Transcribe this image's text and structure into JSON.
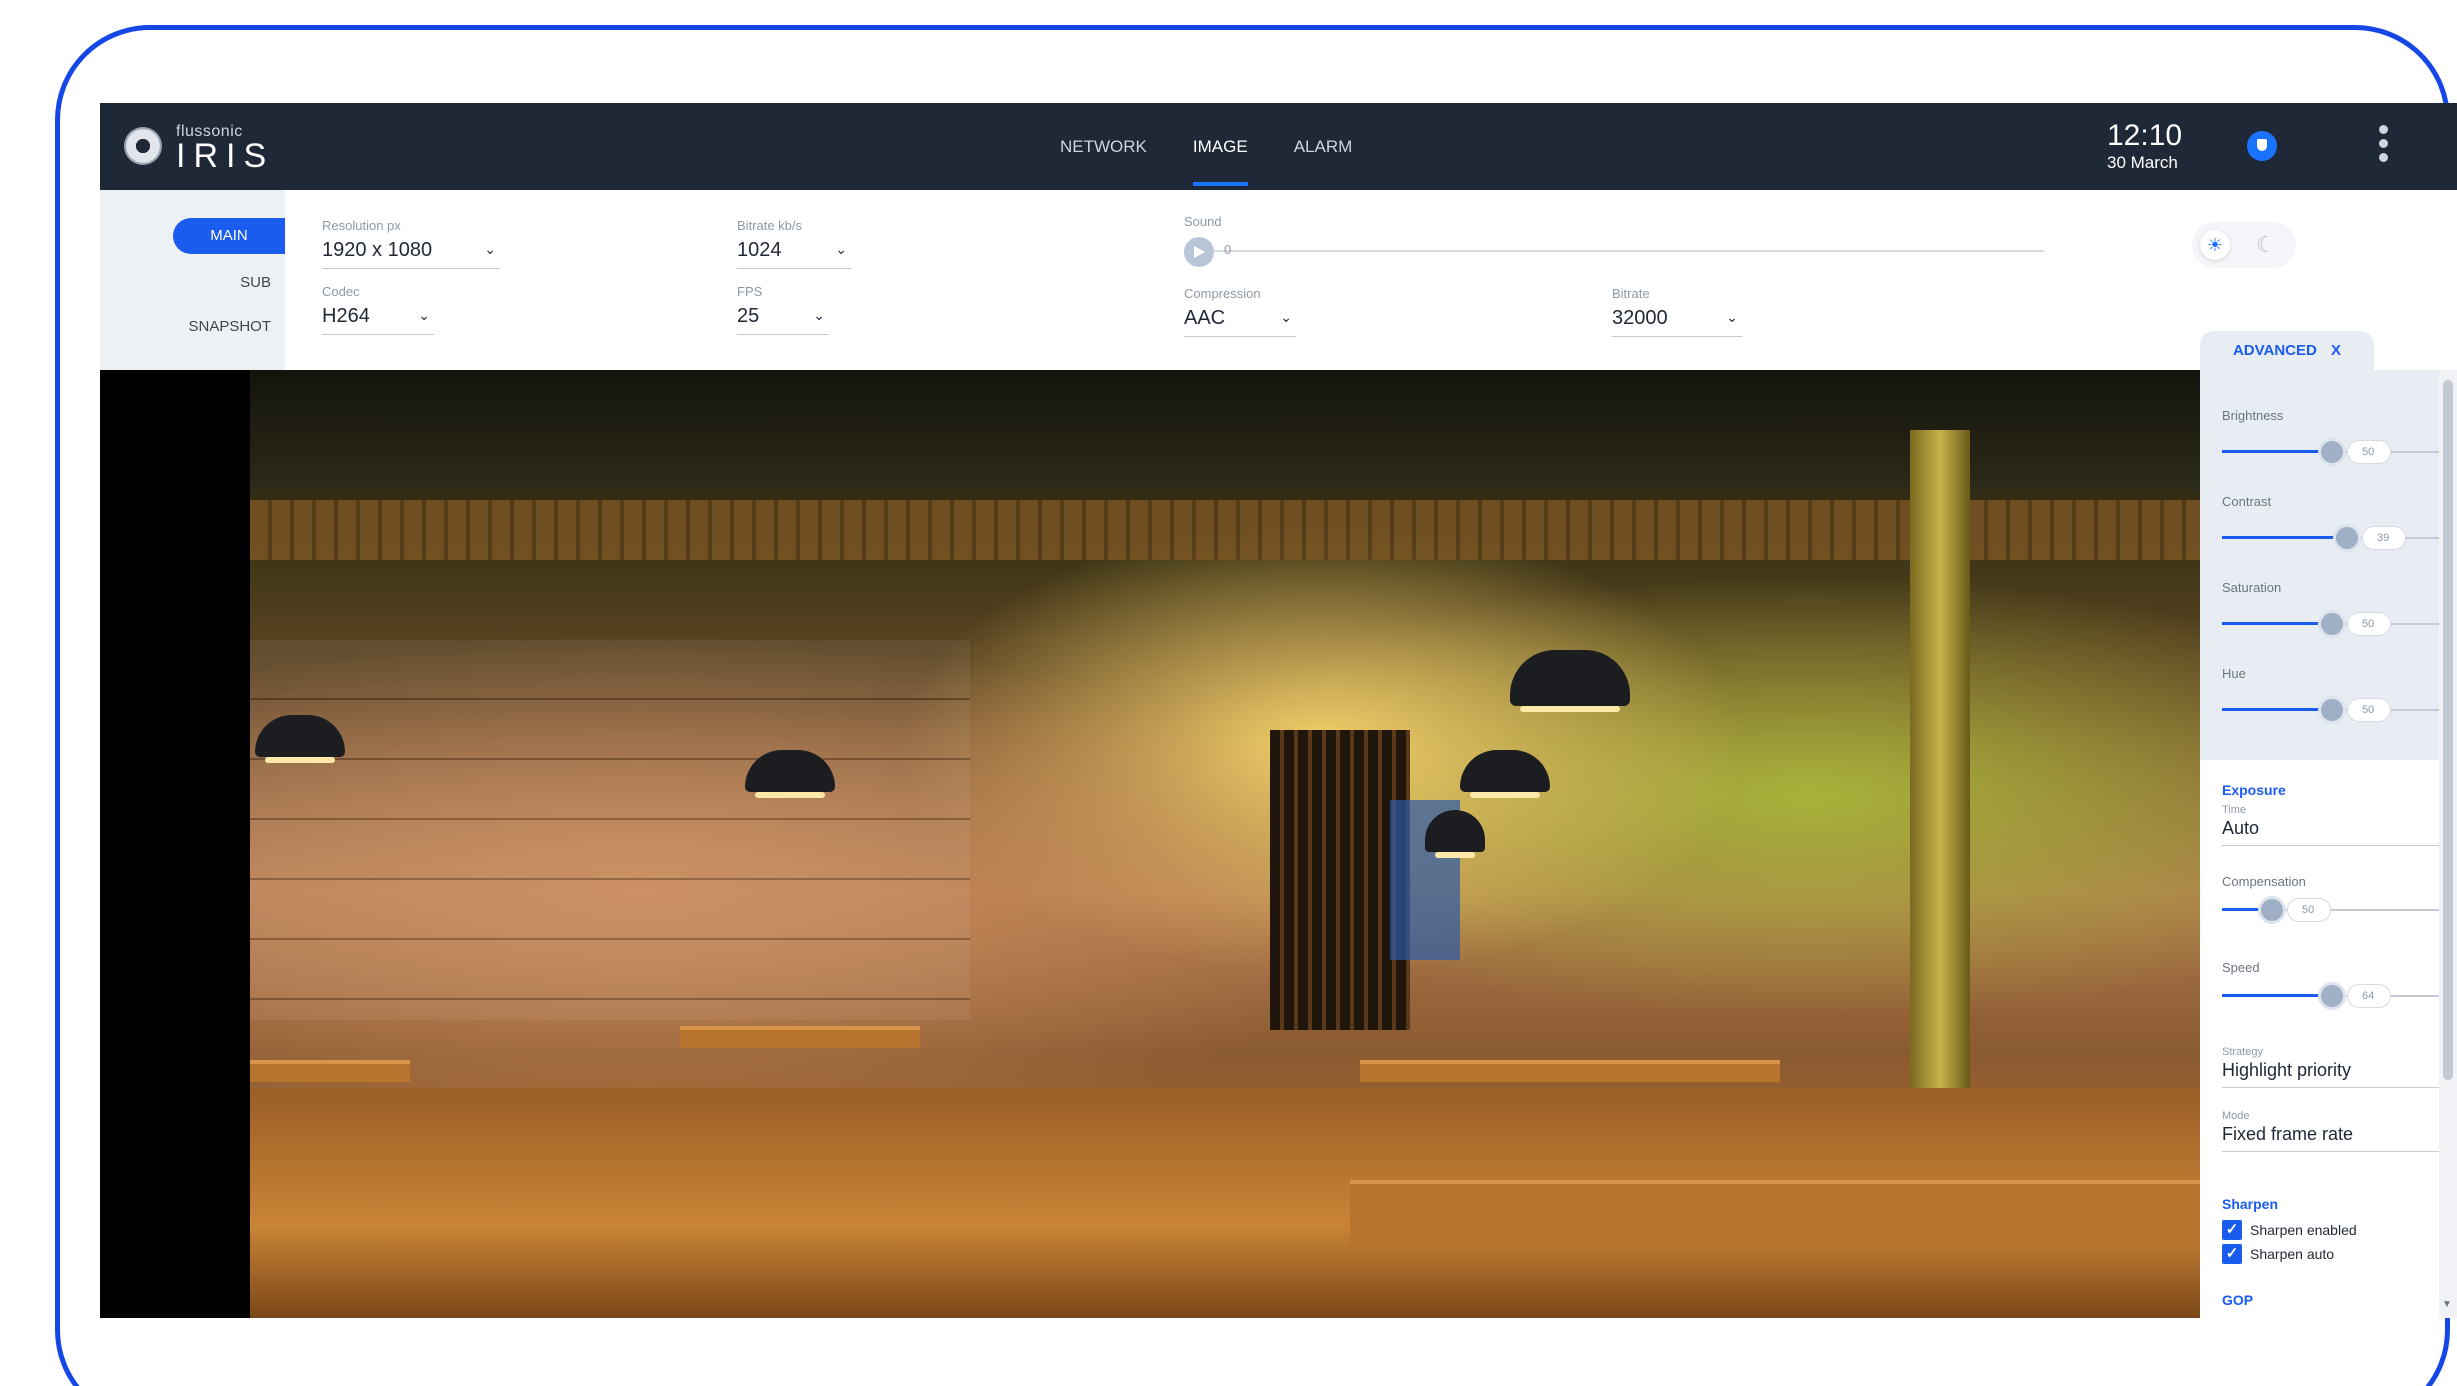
{
  "app": {
    "brand_small": "flussonic",
    "brand_big": "IRIS"
  },
  "nav": {
    "tabs": [
      {
        "label": "NETWORK"
      },
      {
        "label": "IMAGE"
      },
      {
        "label": "ALARM"
      }
    ],
    "active_tab": "IMAGE"
  },
  "clock": {
    "time": "12:10",
    "date": "30 March"
  },
  "streams": {
    "items": [
      {
        "label": "MAIN"
      },
      {
        "label": "SUB"
      },
      {
        "label": "SNAPSHOT"
      }
    ],
    "active": "MAIN"
  },
  "video": {
    "resolution": {
      "label": "Resolution px",
      "value": "1920 x 1080"
    },
    "bitrate": {
      "label": "Bitrate kb/s",
      "value": "1024"
    },
    "codec": {
      "label": "Codec",
      "value": "H264"
    },
    "fps": {
      "label": "FPS",
      "value": "25"
    }
  },
  "audio": {
    "sound": {
      "label": "Sound",
      "value": "0"
    },
    "compression": {
      "label": "Compression",
      "value": "AAC"
    },
    "bitrate": {
      "label": "Bitrate",
      "value": "32000"
    }
  },
  "advanced": {
    "tab_label": "ADVANCED",
    "close_label": "X",
    "image": [
      {
        "label": "Brightness",
        "value": "50",
        "level": 0.5
      },
      {
        "label": "Contrast",
        "value": "39",
        "level": 0.55
      },
      {
        "label": "Saturation",
        "value": "50",
        "level": 0.5
      },
      {
        "label": "Hue",
        "value": "50",
        "level": 0.5
      }
    ],
    "exposure": {
      "title": "Exposure",
      "time": {
        "label": "Time",
        "value": "Auto"
      },
      "compensation": {
        "label": "Compensation",
        "value": "50",
        "level": 0.2
      },
      "speed": {
        "label": "Speed",
        "value": "64",
        "level": 0.5
      },
      "strategy": {
        "label": "Strategy",
        "value": "Highlight priority"
      },
      "mode": {
        "label": "Mode",
        "value": "Fixed frame rate"
      }
    },
    "sharpen": {
      "title": "Sharpen",
      "enabled_label": "Sharpen enabled",
      "auto_label": "Sharpen auto"
    },
    "gop_title": "GOP"
  }
}
